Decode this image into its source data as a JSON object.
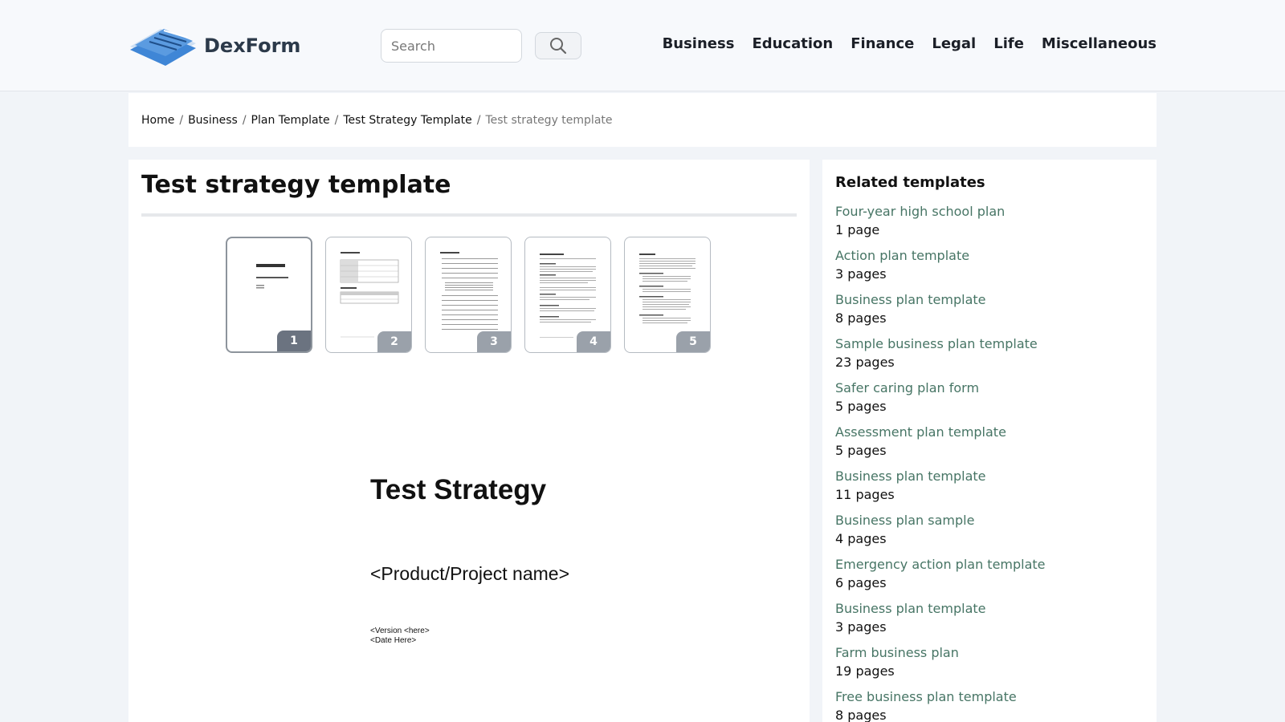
{
  "header": {
    "brand": "DexForm",
    "search_placeholder": "Search",
    "nav": [
      "Business",
      "Education",
      "Finance",
      "Legal",
      "Life",
      "Miscellaneous"
    ]
  },
  "breadcrumb": {
    "items": [
      "Home",
      "Business",
      "Plan Template",
      "Test Strategy Template"
    ],
    "current": "Test strategy template"
  },
  "main": {
    "title": "Test strategy template",
    "thumbnails": [
      "1",
      "2",
      "3",
      "4",
      "5"
    ],
    "preview": {
      "doc_title": "Test Strategy",
      "product_name": "<Product/Project name>",
      "version": "<Version <here>",
      "date": "<Date Here>"
    }
  },
  "sidebar": {
    "heading": "Related templates",
    "items": [
      {
        "title": "Four-year high school plan",
        "pages": "1 page"
      },
      {
        "title": "Action plan template",
        "pages": "3 pages"
      },
      {
        "title": "Business plan template",
        "pages": "8 pages"
      },
      {
        "title": "Sample business plan template",
        "pages": "23 pages"
      },
      {
        "title": "Safer caring plan form",
        "pages": "5 pages"
      },
      {
        "title": "Assessment plan template",
        "pages": "5 pages"
      },
      {
        "title": "Business plan template",
        "pages": "11 pages"
      },
      {
        "title": "Business plan sample",
        "pages": "4 pages"
      },
      {
        "title": "Emergency action plan template",
        "pages": "6 pages"
      },
      {
        "title": "Business plan template",
        "pages": "3 pages"
      },
      {
        "title": "Farm business plan",
        "pages": "19 pages"
      },
      {
        "title": "Free business plan template",
        "pages": "8 pages"
      }
    ]
  },
  "colors": {
    "link": "#477565",
    "thumb_badge_active": "#6b7380",
    "thumb_badge": "#9aa1aa"
  }
}
